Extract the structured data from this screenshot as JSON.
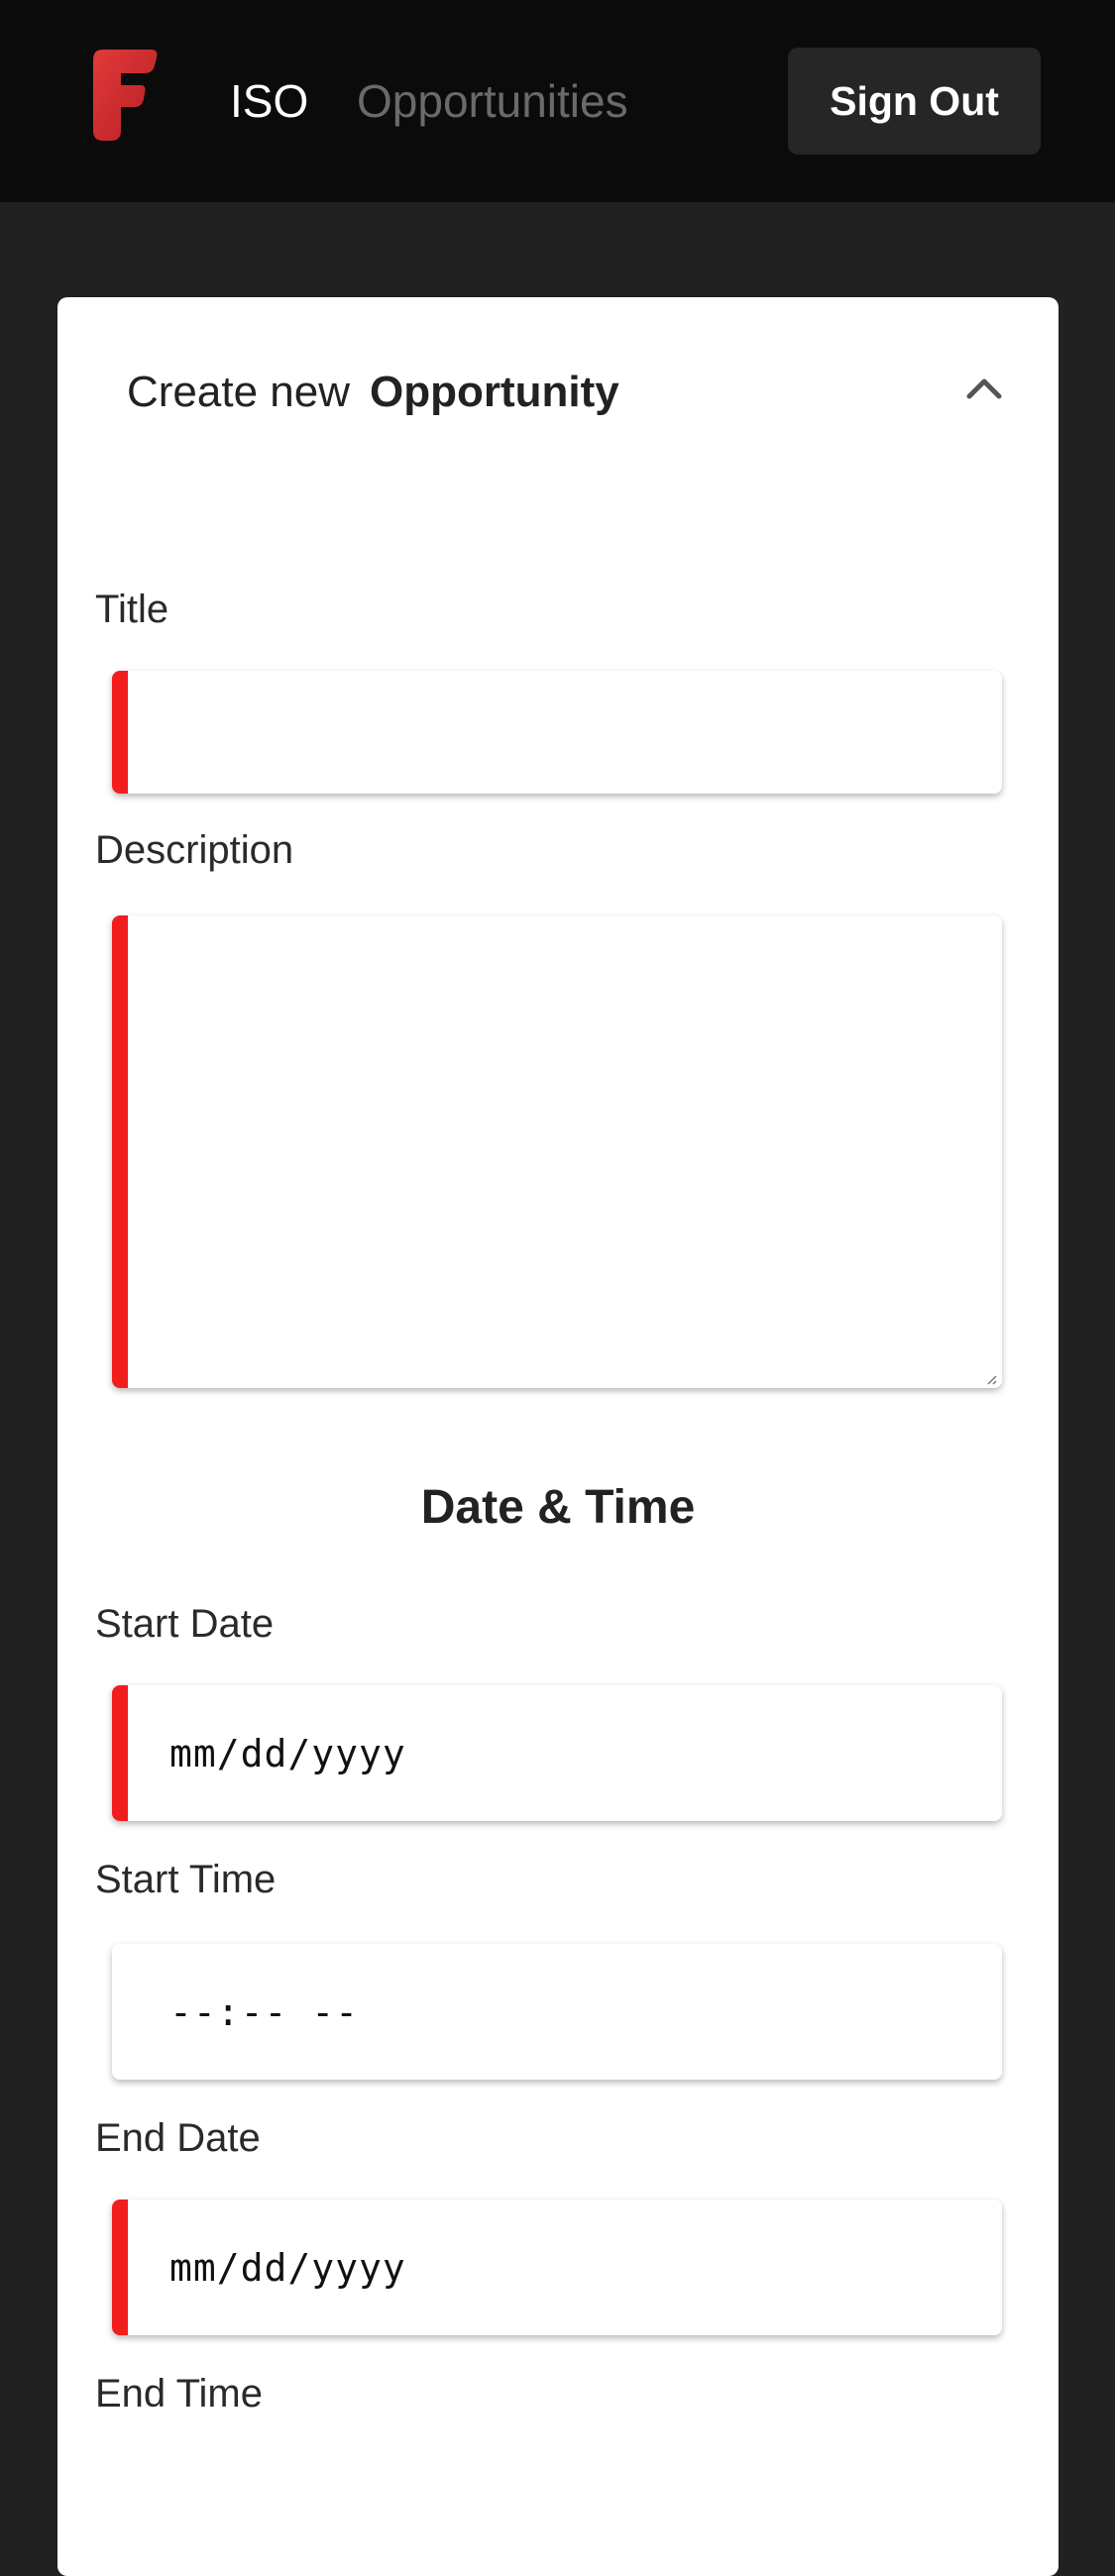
{
  "nav": {
    "logo": "brand-logo",
    "iso_label": "ISO",
    "opportunities_label": "Opportunities",
    "signout_label": "Sign Out"
  },
  "card": {
    "header_prefix": "Create new",
    "header_strong": "Opportunity",
    "collapse_icon": "chevron-up-icon"
  },
  "form": {
    "title_label": "Title",
    "title_value": "",
    "description_label": "Description",
    "description_value": "",
    "datetime_heading": "Date & Time",
    "start_date_label": "Start Date",
    "start_date_placeholder": "mm/dd/yyyy",
    "start_time_label": "Start Time",
    "start_time_placeholder": "--:-- --",
    "end_date_label": "End Date",
    "end_date_placeholder": "mm/dd/yyyy",
    "end_time_label": "End Time"
  },
  "colors": {
    "navbar_bg": "#0b0b0b",
    "page_bg": "#212121",
    "accent_red": "#f21d1d",
    "nav_inactive": "#6a6a6a"
  }
}
